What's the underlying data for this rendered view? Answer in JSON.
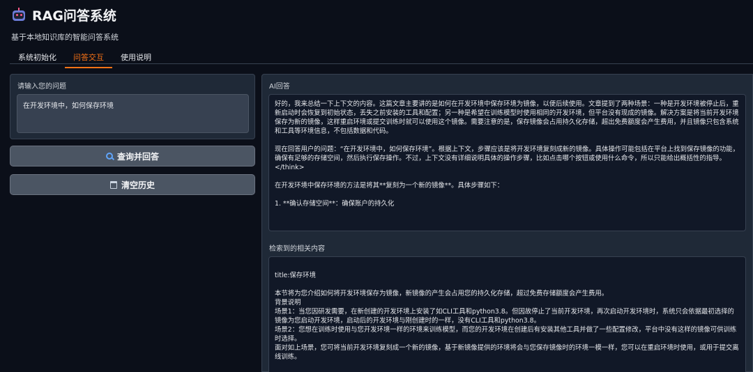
{
  "app": {
    "title": "RAG问答系统",
    "subtitle": "基于本地知识库的智能问答系统"
  },
  "tabs": [
    {
      "label": "系统初始化",
      "active": false
    },
    {
      "label": "问答交互",
      "active": true
    },
    {
      "label": "使用说明",
      "active": false
    }
  ],
  "question": {
    "label": "请输入您的问题",
    "value": "在开发环境中，如何保存环境"
  },
  "buttons": {
    "query_label": "查询并回答",
    "clear_label": "清空历史"
  },
  "answer": {
    "label": "AI回答",
    "paragraphs": [
      "好的，我来总结一下上下文的内容。这篇文章主要讲的是如何在开发环境中保存环境为镜像，以便后续使用。文章提到了两种场景：一种是开发环境被停止后，重新启动时会恢复到初始状态，丢失之前安装的工具和配置；另一种是希望在训练模型时使用相同的开发环境，但平台没有现成的镜像。解决方案是将当前开发环境保存为新的镜像，这样重启环境或提交训练时就可以使用这个镜像。需要注意的是，保存镜像会占用持久化存储，超出免费额度会产生费用，并且镜像只包含系统和工具等环境信息，不包括数据和代码。",
      "现在回答用户的问题：“在开发环境中，如何保存环境”。根据上下文，步骤应该是将开发环境复刻成新的镜像。具体操作可能包括在平台上找到保存镜像的功能，确保有足够的存储空间，然后执行保存操作。不过，上下文没有详细说明具体的操作步骤，比如点击哪个按钮或使用什么命令，所以只能给出概括性的指导。\n</think>",
      "在开发环境中保存环境的方法是将其**复刻为一个新的镜像**。具体步骤如下：",
      "1. **确认存储空间**：确保账户的持久化"
    ]
  },
  "retrieval": {
    "label": "检索到的相关内容",
    "paragraphs": [
      "title:保存环境",
      "本节将为您介绍如何将开发环境保存为镜像，新镜像的产生会占用您的持久化存储，超过免费存储额度会产生费用。\n背景说明\n场景1：当您因研发需要，在新创建的开发环境上安装了如CLI工具和python3.8。但因故停止了当前开发环境，再次启动开发环境时，系统只会依据最初选择的镜像为您启动开发环境，启动后的开发环境与刚创建时的一样，没有CLI工具和python3.8。\n场景2：您想在训练时使用与您开发环境一样的环境来训练模型，而您的开发环境在创建后有安装其他工具并做了一些配置修改，平台中没有这样的镜像可供训练时选择。\n面对如上场景，您可将当前开发环境复刻成一个新的镜像，基于新镜像提供的环境将会与您保存镜像时的环境一模一样，您可以在重启环境时使用，或用于提交离线训练。"
    ]
  }
}
